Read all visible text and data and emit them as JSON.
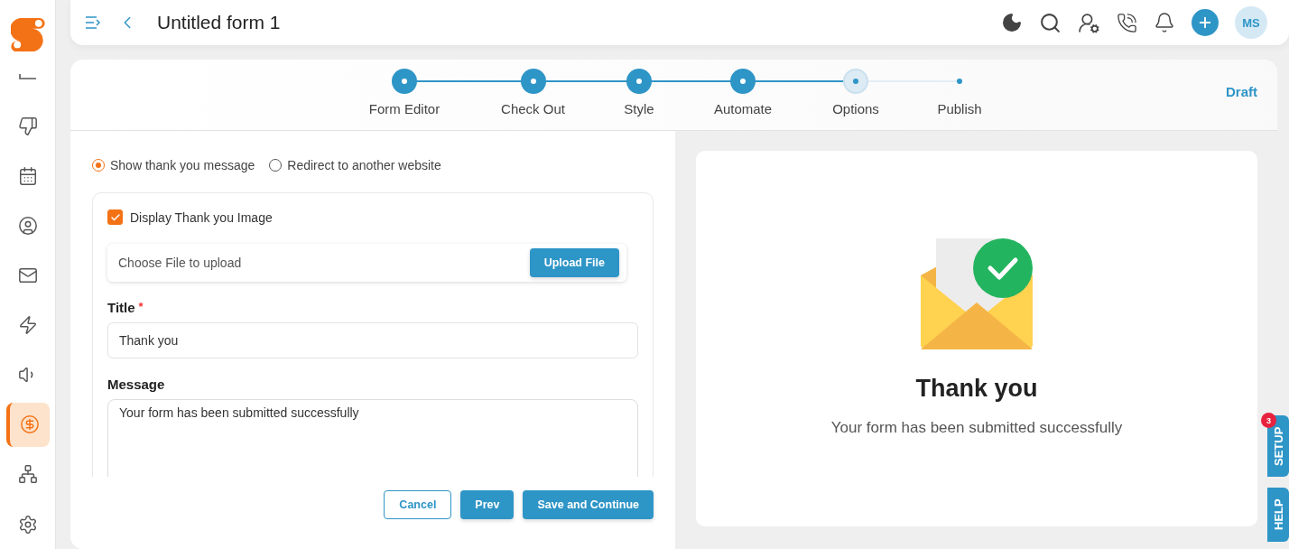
{
  "header": {
    "title": "Untitled form 1",
    "avatar": "MS"
  },
  "sidebar": {
    "items": [
      {
        "selected": false
      },
      {
        "selected": false
      },
      {
        "selected": false
      },
      {
        "selected": false
      },
      {
        "selected": false
      },
      {
        "selected": false
      },
      {
        "selected": false
      },
      {
        "selected": true
      },
      {
        "selected": false
      },
      {
        "selected": false
      }
    ]
  },
  "stepper": {
    "steps": [
      {
        "label": "Form Editor",
        "completed": true,
        "selected": false
      },
      {
        "label": "Check Out",
        "completed": true,
        "selected": false
      },
      {
        "label": "Style",
        "completed": true,
        "selected": false
      },
      {
        "label": "Automate",
        "completed": true,
        "selected": false
      },
      {
        "label": "Options",
        "completed": false,
        "selected": true
      },
      {
        "label": "Publish",
        "completed": false,
        "selected": false
      }
    ],
    "badge": "Draft"
  },
  "form": {
    "radios": [
      {
        "label": "Show thank you message",
        "selected": true
      },
      {
        "label": "Redirect to another website",
        "selected": false
      }
    ],
    "image_checkbox": {
      "label": "Display Thank you Image",
      "checked": true
    },
    "upload": {
      "placeholder": "Choose File to upload",
      "button": "Upload File"
    },
    "title_field": {
      "label": "Title",
      "required_mark": "*",
      "value": "Thank you"
    },
    "message_field": {
      "label": "Message",
      "value": "Your form has been submitted successfully"
    },
    "buttons": [
      {
        "label": "Cancel",
        "kind": "outline"
      },
      {
        "label": "Prev",
        "kind": "primary"
      },
      {
        "label": "Save and Continue",
        "kind": "primary"
      }
    ]
  },
  "preview": {
    "heading": "Thank you",
    "message": "Your form has been submitted successfully"
  },
  "side_tabs": [
    {
      "label": "SETUP",
      "badge": "3"
    },
    {
      "label": "HELP"
    }
  ]
}
